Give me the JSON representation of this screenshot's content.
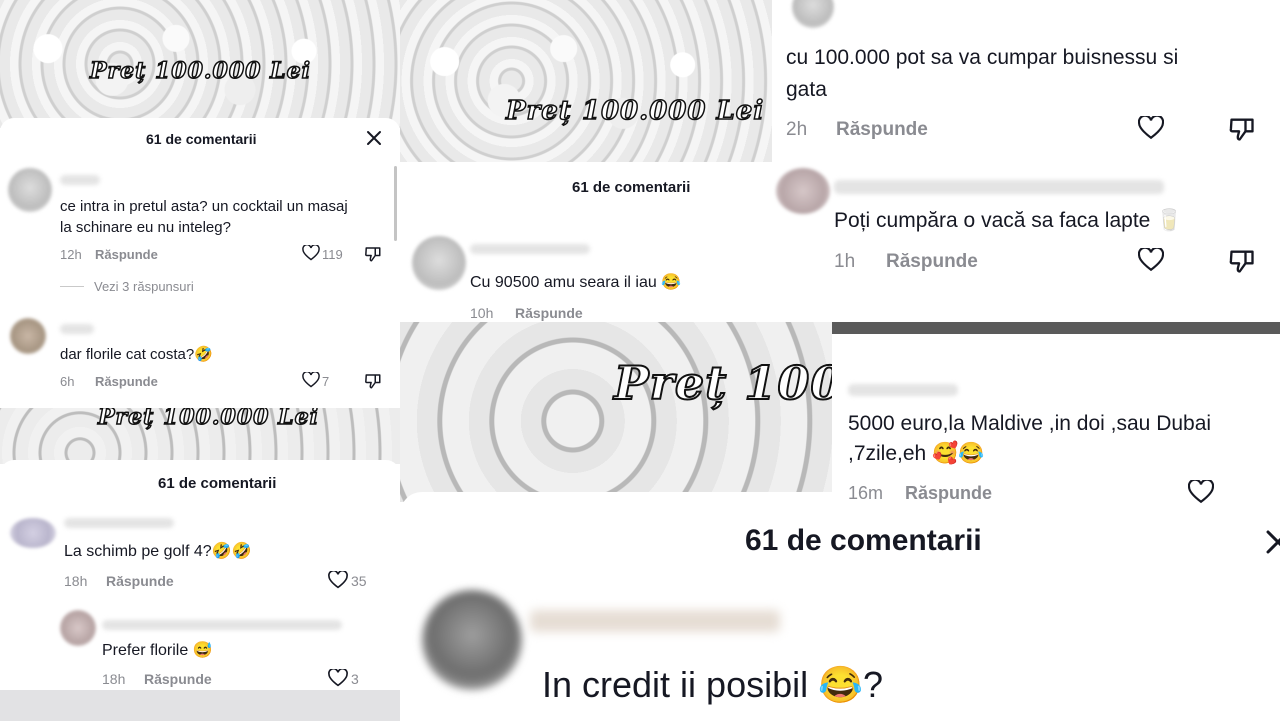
{
  "overlay": {
    "price_label": "Preț 100.000 Lei",
    "price_label_short": "Preț 100."
  },
  "comment_count_title": "61 de comentarii",
  "reply_label": "Răspunde",
  "icons": {
    "like": "heart-outline-icon",
    "dislike": "thumb-down-icon",
    "close": "close-icon"
  },
  "panel_a": {
    "comments": [
      {
        "text_line1": "ce intra in pretul asta? un cocktail un masaj",
        "text_line2": "la schinare eu nu inteleg?",
        "time": "12h",
        "likes": "119"
      },
      {
        "text_line1": "dar florile cat costa?🤣",
        "time": "6h",
        "likes": "7"
      }
    ],
    "view_replies": "Vezi 3 răspunsuri"
  },
  "panel_b": {
    "comments": [
      {
        "text_line1": "Cu 90500 amu seara il iau 😂",
        "time": "10h"
      }
    ]
  },
  "panel_c": {
    "comments": [
      {
        "text_line1": "cu 100.000 pot sa va cumpar buisnessu si",
        "text_line2": "gata",
        "time": "2h"
      },
      {
        "text_line1": "Poți cumpăra o vacă sa faca lapte 🥛",
        "time": "1h"
      }
    ]
  },
  "panel_d": {
    "comments": [
      {
        "text_line1": "La schimb pe golf 4?🤣🤣",
        "time": "18h",
        "likes": "35"
      },
      {
        "text_line1": "Prefer florile 😅",
        "time": "18h",
        "likes": "3"
      }
    ]
  },
  "panel_e": {
    "comments": [
      {
        "text_line1": "5000 euro,la Maldive ,in doi ,sau Dubai",
        "text_line2": ",7zile,eh 🥰😂",
        "time": "16m"
      }
    ]
  },
  "panel_f": {
    "comments": [
      {
        "text_line1": "In credit ii posibil 😂?"
      }
    ]
  }
}
